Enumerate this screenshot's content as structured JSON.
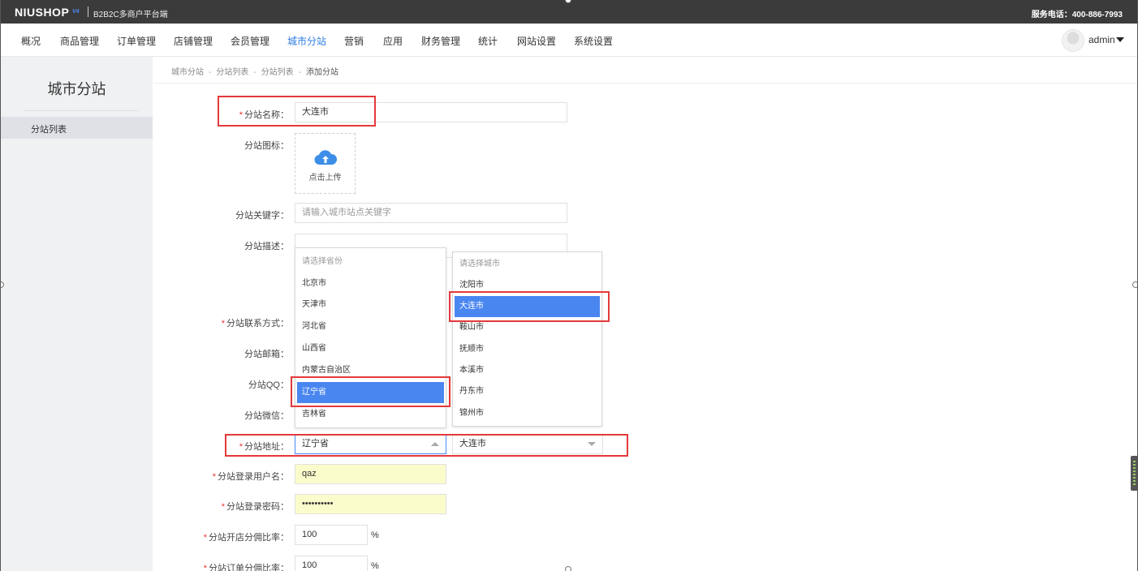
{
  "topbar": {
    "logo": "NIUSHOP",
    "logo_version": "V4",
    "subtitle": "B2B2C多商户平台端",
    "hotline": "服务电话：400-886-7993"
  },
  "nav": {
    "items": [
      "概况",
      "商品管理",
      "订单管理",
      "店铺管理",
      "会员管理",
      "城市分站",
      "营销",
      "应用",
      "财务管理",
      "统计",
      "网站设置",
      "系统设置"
    ],
    "active": "城市分站",
    "user": "admin"
  },
  "sidebar": {
    "title": "城市分站",
    "items": [
      "分站列表"
    ]
  },
  "breadcrumb": [
    "城市分站",
    "分站列表",
    "分站列表",
    "添加分站"
  ],
  "form": {
    "name_label": "分站名称：",
    "name_value": "大连市",
    "icon_label": "分站图标：",
    "upload_text": "点击上传",
    "keywords_label": "分站关键字：",
    "keywords_placeholder": "请输入城市站点关键字",
    "desc_label": "分站描述：",
    "contact_label": "分站联系方式：",
    "email_label": "分站邮箱：",
    "qq_label": "分站QQ：",
    "wechat_label": "分站微信：",
    "address_label": "分站地址：",
    "province_value": "辽宁省",
    "city_value": "大连市",
    "username_label": "分站登录用户名：",
    "username_value": "qaz",
    "password_label": "分站登录密码：",
    "password_value": "••••••••••",
    "open_rate_label": "分站开店分佣比率：",
    "open_rate_value": "100",
    "order_rate_label": "分站订单分佣比率：",
    "order_rate_value": "100",
    "percent": "%"
  },
  "province_dropdown": {
    "placeholder": "请选择省份",
    "options": [
      "北京市",
      "天津市",
      "河北省",
      "山西省",
      "内蒙古自治区",
      "辽宁省",
      "吉林省"
    ],
    "selected": "辽宁省"
  },
  "city_dropdown": {
    "placeholder": "请选择城市",
    "options": [
      "沈阳市",
      "大连市",
      "鞍山市",
      "抚顺市",
      "本溪市",
      "丹东市",
      "锦州市"
    ],
    "selected": "大连市"
  },
  "colors": {
    "accent": "#4a86f0",
    "nav_active": "#2e7de1",
    "annotation": "#e4393c",
    "topbar": "#3b3b3b"
  }
}
